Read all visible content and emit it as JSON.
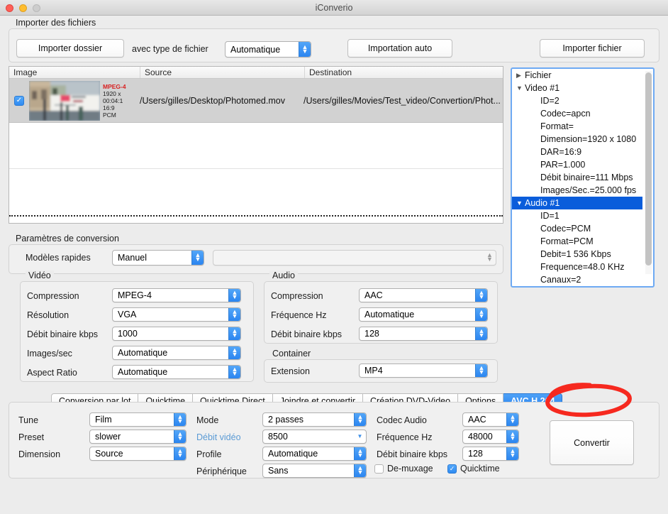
{
  "window": {
    "title": "iConverio",
    "controls": {
      "close": "close",
      "minimize": "minimize",
      "zoom": "zoom"
    }
  },
  "import_section": {
    "legend": "Importer des fichiers",
    "import_folder_button": "Importer dossier",
    "file_type_label": "avec type de fichier",
    "file_type_value": "Automatique",
    "auto_import_button": "Importation auto",
    "import_file_button": "Importer fichier"
  },
  "file_table": {
    "columns": [
      "Image",
      "Source",
      "Destination"
    ],
    "rows": [
      {
        "checked": true,
        "checkmark": "✓",
        "meta": {
          "format": "MPEG-4",
          "width": "1920 x",
          "duration": "00:04:1",
          "aspect": "16:9",
          "audio": "PCM"
        },
        "source": "/Users/gilles/Desktop/Photomed.mov",
        "destination": "/Users/gilles/Movies/Test_video/Convertion/Phot..."
      }
    ]
  },
  "info_tree": {
    "nodes": [
      {
        "disclosure": "▶",
        "label": "Fichier",
        "indent": 0,
        "selected": false
      },
      {
        "disclosure": "▼",
        "label": "Video #1",
        "indent": 0,
        "selected": false
      },
      {
        "disclosure": "",
        "label": "ID=2",
        "indent": 1,
        "selected": false
      },
      {
        "disclosure": "",
        "label": "Codec=apcn",
        "indent": 1,
        "selected": false
      },
      {
        "disclosure": "",
        "label": "Format=",
        "indent": 1,
        "selected": false
      },
      {
        "disclosure": "",
        "label": "Dimension=1920 x 1080",
        "indent": 1,
        "selected": false
      },
      {
        "disclosure": "",
        "label": "DAR=16:9",
        "indent": 1,
        "selected": false
      },
      {
        "disclosure": "",
        "label": "PAR=1.000",
        "indent": 1,
        "selected": false
      },
      {
        "disclosure": "",
        "label": "Débit binaire=111 Mbps",
        "indent": 1,
        "selected": false
      },
      {
        "disclosure": "",
        "label": "Images/Sec.=25.000 fps",
        "indent": 1,
        "selected": false
      },
      {
        "disclosure": "▼",
        "label": "Audio #1",
        "indent": 0,
        "selected": true
      },
      {
        "disclosure": "",
        "label": "ID=1",
        "indent": 1,
        "selected": false
      },
      {
        "disclosure": "",
        "label": "Codec=PCM",
        "indent": 1,
        "selected": false
      },
      {
        "disclosure": "",
        "label": "Format=PCM",
        "indent": 1,
        "selected": false
      },
      {
        "disclosure": "",
        "label": "Debit=1 536 Kbps",
        "indent": 1,
        "selected": false
      },
      {
        "disclosure": "",
        "label": "Frequence=48.0 KHz",
        "indent": 1,
        "selected": false
      },
      {
        "disclosure": "",
        "label": "Canaux=2",
        "indent": 1,
        "selected": false
      }
    ]
  },
  "conversion": {
    "legend": "Paramètres de conversion",
    "quick_models_label": "Modèles rapides",
    "quick_models_value": "Manuel",
    "quick_models_second_value": "",
    "video": {
      "legend": "Vidéo",
      "rows": [
        {
          "label": "Compression",
          "value": "MPEG-4"
        },
        {
          "label": "Résolution",
          "value": "VGA"
        },
        {
          "label": "Débit binaire kbps",
          "value": "1000"
        },
        {
          "label": "Images/sec",
          "value": "Automatique"
        },
        {
          "label": "Aspect Ratio",
          "value": "Automatique"
        }
      ]
    },
    "audio": {
      "legend": "Audio",
      "rows": [
        {
          "label": "Compression",
          "value": "AAC"
        },
        {
          "label": "Fréquence Hz",
          "value": "Automatique"
        },
        {
          "label": "Débit binaire kbps",
          "value": "128"
        }
      ]
    },
    "container": {
      "legend": "Container",
      "rows": [
        {
          "label": "Extension",
          "value": "MP4"
        }
      ]
    }
  },
  "tabs": [
    {
      "label": "Conversion par lot",
      "active": false
    },
    {
      "label": "Quicktime",
      "active": false
    },
    {
      "label": "Quicktime Direct",
      "active": false
    },
    {
      "label": "Joindre et convertir",
      "active": false
    },
    {
      "label": "Création DVD-Video",
      "active": false
    },
    {
      "label": "Options",
      "active": false
    },
    {
      "label": "AVC H.264",
      "active": true
    }
  ],
  "avc_panel": {
    "col1": [
      {
        "label": "Tune",
        "value": "Film"
      },
      {
        "label": "Preset",
        "value": "slower"
      },
      {
        "label": "Dimension",
        "value": "Source"
      }
    ],
    "col2": [
      {
        "label": "Mode",
        "value": "2 passes",
        "blue": false
      },
      {
        "label": "Débit vidéo",
        "value": "8500",
        "blue": true
      },
      {
        "label": "Profile",
        "value": "Automatique",
        "blue": false
      },
      {
        "label": "Périphérique",
        "value": "Sans",
        "blue": false
      }
    ],
    "col3": [
      {
        "label": "Codec Audio",
        "value": "AAC"
      },
      {
        "label": "Fréquence Hz",
        "value": "48000"
      },
      {
        "label": "Débit binaire kbps",
        "value": "128"
      }
    ],
    "checkboxes": [
      {
        "label": "De-muxage",
        "checked": false,
        "mark": ""
      },
      {
        "label": "Quicktime",
        "checked": true,
        "mark": "✓"
      }
    ],
    "convert_button": "Convertir"
  },
  "annotation": {
    "shape": "red-ellipse",
    "color": "#f6291f",
    "target": "AVC H.264"
  },
  "colors": {
    "accent_blue": "#2a84f0",
    "selection_blue": "#0a5ddb",
    "annotation_red": "#f6291f",
    "format_red": "#d81f1f",
    "window_bg": "#ececec"
  }
}
